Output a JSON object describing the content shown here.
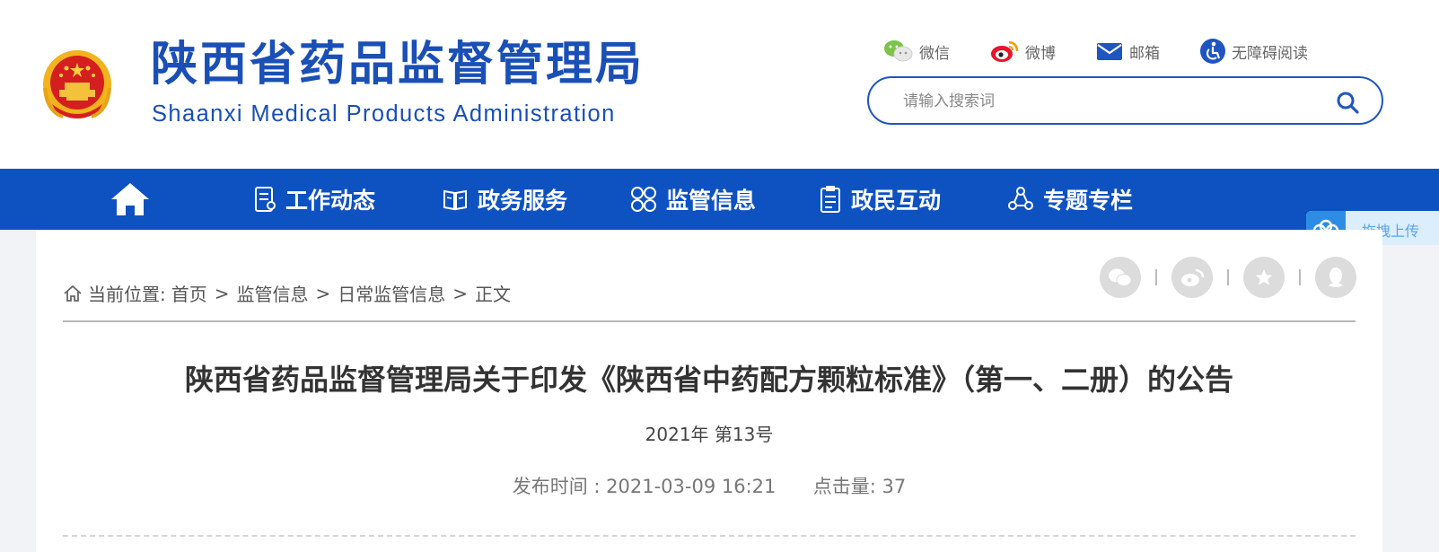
{
  "header": {
    "title": "陕西省药品监督管理局",
    "subtitle": "Shaanxi Medical Products Administration",
    "emblem_icon": "national-emblem-icon",
    "brand_color": "#1a4fb6"
  },
  "top_links": [
    {
      "label": "微信",
      "icon": "wechat-icon"
    },
    {
      "label": "微博",
      "icon": "weibo-icon"
    },
    {
      "label": "邮箱",
      "icon": "mail-icon"
    },
    {
      "label": "无障碍阅读",
      "icon": "accessibility-icon"
    }
  ],
  "search": {
    "placeholder": "请输入搜索词",
    "value": "",
    "icon": "search-icon"
  },
  "nav": {
    "background": "#0e52c2",
    "home_icon": "home-icon",
    "items": [
      {
        "label": "工作动态",
        "icon": "document-list-icon"
      },
      {
        "label": "政务服务",
        "icon": "book-icon"
      },
      {
        "label": "监管信息",
        "icon": "grid-icon"
      },
      {
        "label": "政民互动",
        "icon": "clipboard-icon"
      },
      {
        "label": "专题专栏",
        "icon": "share-nodes-icon"
      }
    ]
  },
  "upload_tab": {
    "label": "拖拽上传",
    "icon": "cloud-icon"
  },
  "breadcrumb": {
    "prefix": "当前位置:",
    "items": [
      "首页",
      "监管信息",
      "日常监管信息"
    ],
    "current": "正文",
    "separator": ">"
  },
  "share": [
    "wechat-share-icon",
    "weibo-share-icon",
    "favorite-star-icon",
    "qq-share-icon"
  ],
  "article": {
    "title": "陕西省药品监督管理局关于印发《陕西省中药配方颗粒标准》（第一、二册）的公告",
    "doc_number": "2021年 第13号",
    "publish_label": "发布时间 :",
    "publish_time": "2021-03-09 16:21",
    "views_label": "点击量:",
    "views": "37"
  }
}
